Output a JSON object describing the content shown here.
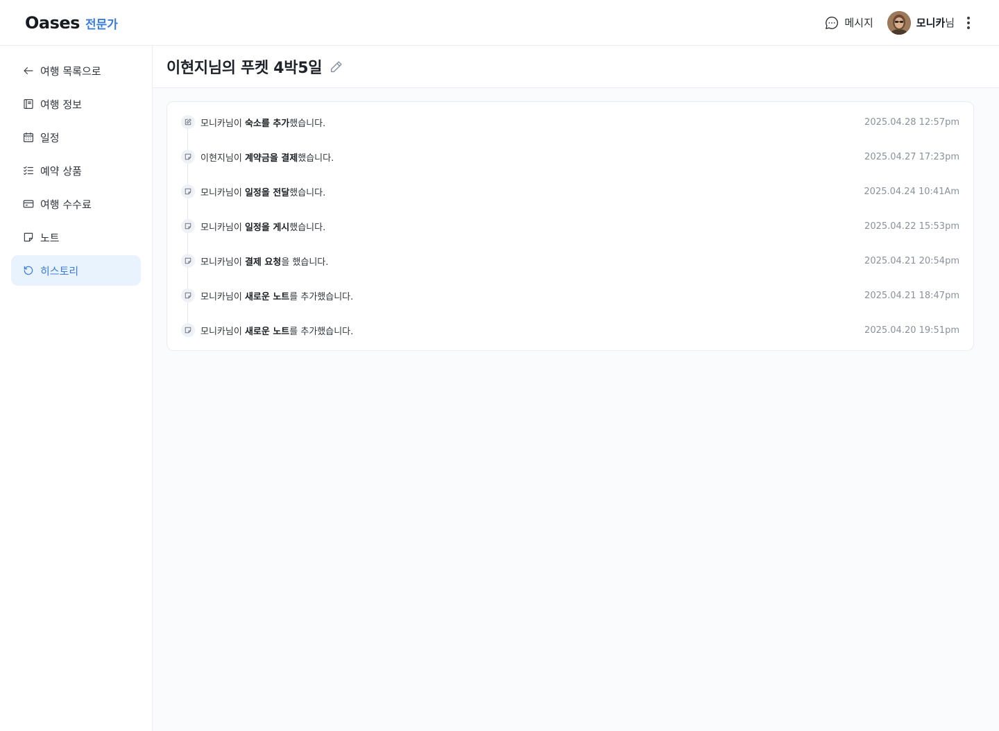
{
  "header": {
    "logo": "Oases",
    "logo_sub": "전문가",
    "messages_label": "메시지",
    "user_name": "모니카",
    "user_suffix": "님"
  },
  "sidebar": {
    "items": [
      {
        "label": "여행 목록으로",
        "icon": "arrow-left-icon"
      },
      {
        "label": "여행 정보",
        "icon": "book-icon"
      },
      {
        "label": "일정",
        "icon": "calendar-icon"
      },
      {
        "label": "예약 상품",
        "icon": "checklist-icon"
      },
      {
        "label": "여행 수수료",
        "icon": "credit-card-icon"
      },
      {
        "label": "노트",
        "icon": "note-icon"
      },
      {
        "label": "히스토리",
        "icon": "history-icon",
        "active": true
      }
    ]
  },
  "page": {
    "title": "이현지님의 푸켓 4박5일"
  },
  "history": [
    {
      "icon": "edit-icon",
      "actor": "모니카님이 ",
      "action": "숙소를 추가",
      "suffix": "했습니다.",
      "time": "2025.04.28 12:57pm"
    },
    {
      "icon": "note-icon",
      "actor": "이현지님이 ",
      "action": "계약금을 결제",
      "suffix": "했습니다.",
      "time": "2025.04.27 17:23pm"
    },
    {
      "icon": "note-icon",
      "actor": "모니카님이 ",
      "action": "일정을 전달",
      "suffix": "했습니다.",
      "time": "2025.04.24 10:41Am"
    },
    {
      "icon": "note-icon",
      "actor": "모니카님이 ",
      "action": "일정을 게시",
      "suffix": "했습니다.",
      "time": "2025.04.22 15:53pm"
    },
    {
      "icon": "note-icon",
      "actor": "모니카님이 ",
      "action": "결제 요청",
      "suffix": "을 했습니다.",
      "time": "2025.04.21 20:54pm"
    },
    {
      "icon": "note-icon",
      "actor": "모니카님이 ",
      "action": "새로운 노트",
      "suffix": "를 추가했습니다.",
      "time": "2025.04.21 18:47pm"
    },
    {
      "icon": "note-icon",
      "actor": "모니카님이 ",
      "action": "새로운 노트",
      "suffix": "를 추가했습니다.",
      "time": "2025.04.20 19:51pm"
    }
  ],
  "colors": {
    "accent": "#3a7be0",
    "active_bg": "#e8f3fe",
    "border": "#e9ecf1",
    "main_bg": "#fafbfd"
  }
}
